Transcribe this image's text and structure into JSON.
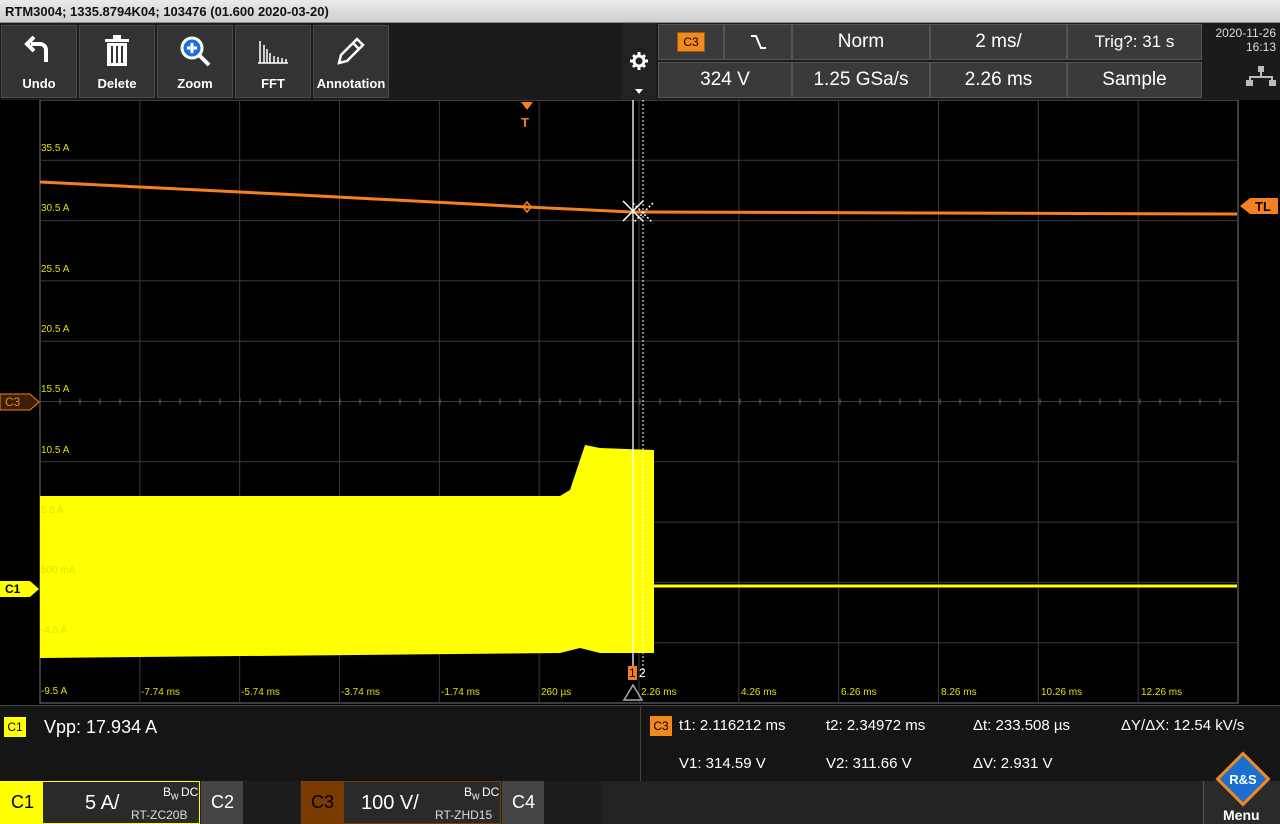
{
  "titlebar": {
    "text": "RTM3004; 1335.8794K04; 103476 (01.600 2020-03-20)"
  },
  "toolbar": {
    "undo": "Undo",
    "delete": "Delete",
    "zoom": "Zoom",
    "fft": "FFT",
    "annotation": "Annotation"
  },
  "header": {
    "trigger_source": "C3",
    "slope_icon": "falling-edge-icon",
    "mode": "Norm",
    "timebase": "2 ms/",
    "trig_status": "Trig?: 31 s",
    "trigger_level": "324 V",
    "sample_rate": "1.25 GSa/s",
    "position": "2.26 ms",
    "acquisition": "Sample",
    "date": "2020-11-26",
    "time": "16:13"
  },
  "scope": {
    "trigger_marker": "T",
    "tl_marker": "TL",
    "c3_marker": "C3",
    "c1_marker": "C1",
    "cursor1": "1",
    "cursor2": "2",
    "y_labels": [
      "35.5 A",
      "30.5 A",
      "25.5 A",
      "20.5 A",
      "15.5 A",
      "10.5 A",
      "5.5 A",
      "500 mA",
      "-4.5 A",
      "-9.5 A"
    ],
    "x_labels": [
      "-7.74 ms",
      "-5.74 ms",
      "-3.74 ms",
      "-1.74 ms",
      "260 µs",
      "2.26 ms",
      "4.26 ms",
      "6.26 ms",
      "8.26 ms",
      "10.26 ms",
      "12.26 ms"
    ],
    "colors": {
      "c1": "#ffff00",
      "c3": "#f5801f",
      "grid": "#3c3c3c"
    }
  },
  "measure": {
    "badge": "C1",
    "vpp": "Vpp: 17.934 A"
  },
  "cursors": {
    "badge": "C3",
    "t1": "t1: 2.116212 ms",
    "t2": "t2: 2.34972 ms",
    "dt": "Δt: 233.508 µs",
    "dydx": "ΔY/ΔX: 12.54 kV/s",
    "v1": "V1: 314.59 V",
    "v2": "V2: 311.66 V",
    "dv": "ΔV: 2.931 V"
  },
  "channels": {
    "c1": {
      "name": "C1",
      "scale": "5 A/",
      "coupling": "DC",
      "probe": "RT-ZC20B"
    },
    "c2": {
      "name": "C2"
    },
    "c3": {
      "name": "C3",
      "scale": "100 V/",
      "coupling": "DC",
      "probe": "RT-ZHD15"
    },
    "c4": {
      "name": "C4"
    },
    "menu": "Menu"
  }
}
